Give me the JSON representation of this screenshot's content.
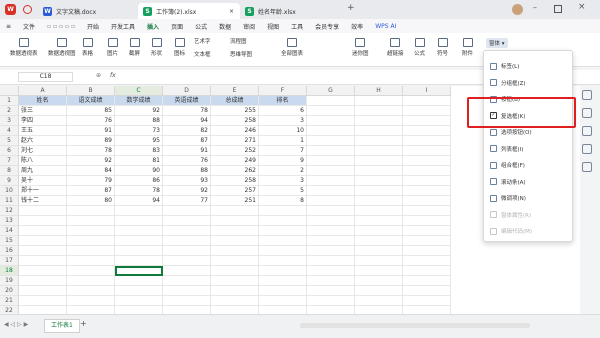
{
  "titlebar": {
    "tabs": [
      {
        "label": "文字文稿.docx",
        "icon": "W",
        "icon_color": "#2a5bd7"
      },
      {
        "label": "工作簿(2).xlsx",
        "icon": "S",
        "icon_color": "#17a05d"
      },
      {
        "label": "姓名年龄.xlsx",
        "icon": "S",
        "icon_color": "#17a05d"
      }
    ]
  },
  "menu": {
    "file": "文件",
    "items": [
      "开始",
      "开发工具",
      "插入",
      "页面",
      "公式",
      "数据",
      "审阅",
      "视图",
      "工具",
      "会员专享",
      "效率"
    ],
    "wps_ai": "WPS AI"
  },
  "ribbon": {
    "pivot_table": "数据透视表",
    "pivot_chart": "数据透视图",
    "table": "表格",
    "picture": "图片",
    "screenshot": "截屏",
    "shape": "形状",
    "icon": "图标",
    "art_text": "艺术字",
    "flowchart": "流程图",
    "textbox": "文本框",
    "mindmap": "思维导图",
    "all_charts": "全部图表",
    "sparkline": "迷你图",
    "hyperlink": "超链接",
    "formula": "公式",
    "symbol": "符号",
    "attachment": "附件",
    "form_control": "窗体"
  },
  "formulabar": {
    "cell_ref": "C18",
    "fx": "fx",
    "value": ""
  },
  "sheet": {
    "columns": [
      "A",
      "B",
      "C",
      "D",
      "E",
      "F",
      "G",
      "H",
      "I"
    ],
    "rows": [
      "1",
      "2",
      "3",
      "4",
      "5",
      "6",
      "7",
      "8",
      "9",
      "10",
      "11",
      "12",
      "13",
      "14",
      "15",
      "16",
      "17",
      "18",
      "19",
      "20",
      "21",
      "22"
    ],
    "header": [
      "姓名",
      "语文成绩",
      "数学成绩",
      "英语成绩",
      "总成绩",
      "排名"
    ],
    "data": [
      [
        "张三",
        "85",
        "92",
        "78",
        "255",
        "6"
      ],
      [
        "李四",
        "76",
        "88",
        "94",
        "258",
        "3"
      ],
      [
        "王五",
        "91",
        "73",
        "82",
        "246",
        "10"
      ],
      [
        "赵六",
        "89",
        "95",
        "87",
        "271",
        "1"
      ],
      [
        "刘七",
        "78",
        "83",
        "91",
        "252",
        "7"
      ],
      [
        "陈八",
        "92",
        "81",
        "76",
        "249",
        "9"
      ],
      [
        "周九",
        "84",
        "90",
        "88",
        "262",
        "2"
      ],
      [
        "吴十",
        "79",
        "86",
        "93",
        "258",
        "3"
      ],
      [
        "郑十一",
        "87",
        "78",
        "92",
        "257",
        "5"
      ],
      [
        "钱十二",
        "80",
        "94",
        "77",
        "251",
        "8"
      ]
    ],
    "selected_cell": "C18"
  },
  "dropdown": {
    "header_label": "窗体",
    "items": [
      {
        "label": "标签(L)",
        "enabled": true
      },
      {
        "label": "分组框(Z)",
        "enabled": true
      },
      {
        "label": "按钮(B)",
        "enabled": true
      },
      {
        "label": "复选框(K)",
        "enabled": true
      },
      {
        "label": "选项按钮(O)",
        "enabled": true
      },
      {
        "label": "列表框(I)",
        "enabled": true
      },
      {
        "label": "组合框(F)",
        "enabled": true
      },
      {
        "label": "滚动条(A)",
        "enabled": true
      },
      {
        "label": "微调项(N)",
        "enabled": true
      },
      {
        "label": "窗体属性(R)",
        "enabled": false
      },
      {
        "label": "编辑代码(M)",
        "enabled": false
      }
    ]
  },
  "status": {
    "sheet_tab": "工作表1",
    "add": "+"
  },
  "colors": {
    "accent_green": "#0e7a3b",
    "highlight_red": "#e02020",
    "header_fill": "#c9d9ee"
  }
}
